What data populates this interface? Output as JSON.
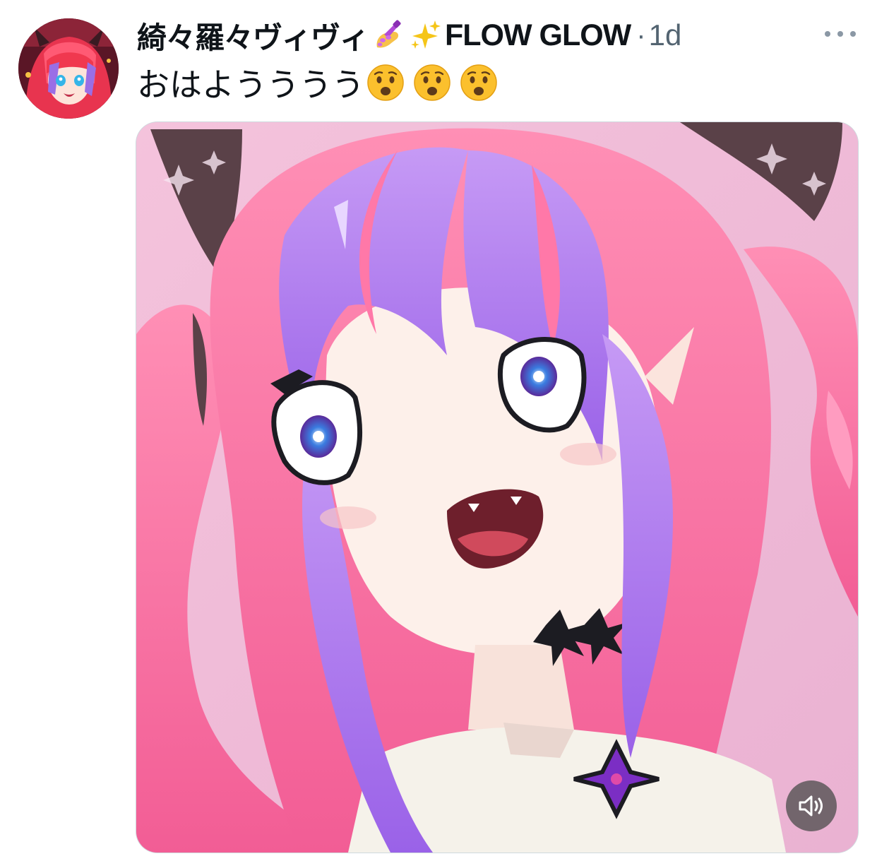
{
  "tweet": {
    "author": {
      "display_name": "綺々羅々ヴィヴィ",
      "name_emoji": [
        "nail-polish-icon",
        "sparkles-icon"
      ],
      "display_name_suffix": "FLOW GLOW",
      "avatar_icon": "avatar"
    },
    "separator": "·",
    "timestamp": "1d",
    "more_icon": "more-options-icon",
    "text": "おはようううう",
    "text_emoji": [
      "anguished-face-icon",
      "anguished-face-icon",
      "anguished-face-icon"
    ],
    "media": {
      "type": "video",
      "volume_icon": "speaker-muted-icon"
    }
  },
  "colors": {
    "text_primary": "#0f1419",
    "text_secondary": "#536471",
    "media_background": "#f0b8d8",
    "hair_pink": "#ff6fa0",
    "hair_purple": "#b27cf2"
  }
}
